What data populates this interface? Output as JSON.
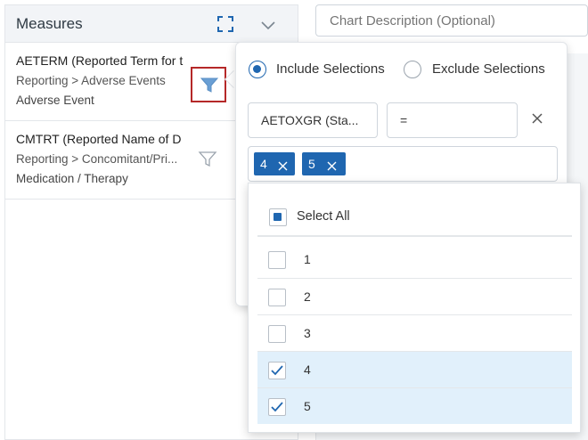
{
  "measures": {
    "title": "Measures",
    "items": [
      {
        "name": "AETERM (Reported Term for t",
        "path": "Reporting > Adverse Events",
        "category": "Adverse Event",
        "filter_active": true
      },
      {
        "name": "CMTRT (Reported Name of D",
        "path": "Reporting > Concomitant/Pri...",
        "category": "Medication / Therapy",
        "filter_active": false
      }
    ]
  },
  "chart_description": {
    "placeholder": "Chart Description (Optional)"
  },
  "filter_popover": {
    "include_label": "Include Selections",
    "exclude_label": "Exclude Selections",
    "mode": "include",
    "field_value": "AETOXGR  (Sta...",
    "operator_value": "=",
    "selected_tags": [
      "4",
      "5"
    ]
  },
  "options_dropdown": {
    "select_all_label": "Select All",
    "options": [
      {
        "label": "1",
        "checked": false
      },
      {
        "label": "2",
        "checked": false
      },
      {
        "label": "3",
        "checked": false
      },
      {
        "label": "4",
        "checked": true
      },
      {
        "label": "5",
        "checked": true
      }
    ]
  },
  "colors": {
    "accent": "#1f66b0",
    "highlight_border": "#b52828",
    "selected_row": "#e1f0fb"
  }
}
